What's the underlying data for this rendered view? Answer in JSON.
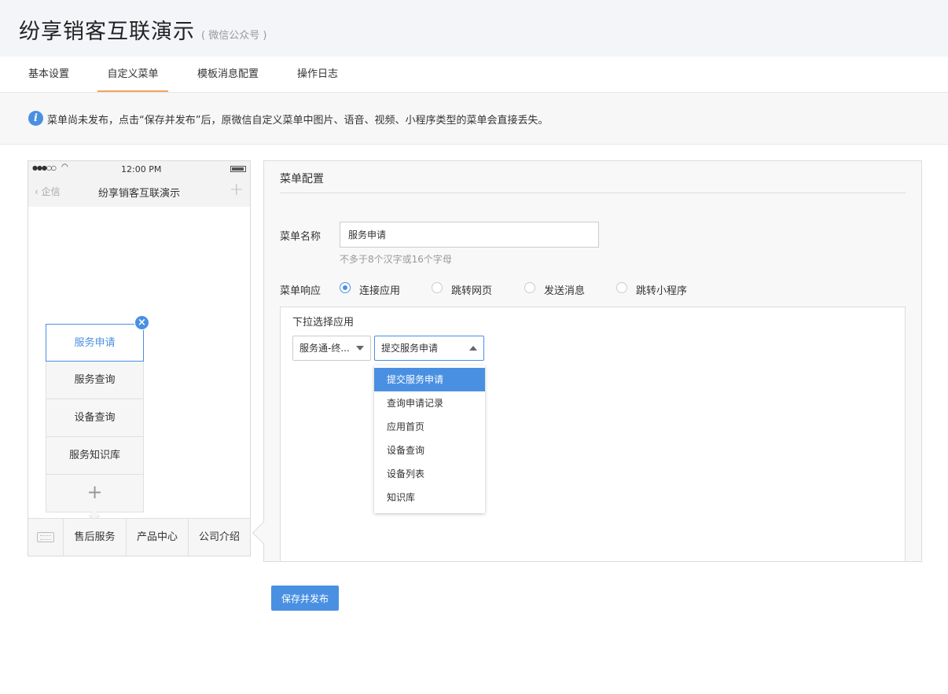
{
  "header": {
    "title": "纷享销客互联演示",
    "subtitle": "( 微信公众号 )"
  },
  "tabs": [
    {
      "label": "基本设置"
    },
    {
      "label": "自定义菜单"
    },
    {
      "label": "模板消息配置"
    },
    {
      "label": "操作日志"
    }
  ],
  "notice": {
    "icon": "info-icon",
    "text": "菜单尚未发布，点击“保存并发布”后，原微信自定义菜单中图片、语音、视频、小程序类型的菜单会直接丢失。"
  },
  "phone": {
    "time": "12:00 PM",
    "back_label": "企信",
    "nav_title": "纷享销客互联演示",
    "submenu": [
      {
        "label": "服务申请"
      },
      {
        "label": "服务查询"
      },
      {
        "label": "设备查询"
      },
      {
        "label": "服务知识库"
      }
    ],
    "menu": [
      {
        "label": "售后服务"
      },
      {
        "label": "产品中心"
      },
      {
        "label": "公司介绍"
      }
    ]
  },
  "config": {
    "title": "菜单配置",
    "name_label": "菜单名称",
    "name_value": "服务申请",
    "name_hint": "不多于8个汉字或16个字母",
    "response_label": "菜单响应",
    "responses": [
      {
        "label": "连接应用"
      },
      {
        "label": "跳转网页"
      },
      {
        "label": "发送消息"
      },
      {
        "label": "跳转小程序"
      }
    ],
    "app_select_label": "下拉选择应用",
    "app_select_value": "服务通-终...",
    "page_select_value": "提交服务申请",
    "page_options": [
      {
        "label": "提交服务申请"
      },
      {
        "label": "查询申请记录"
      },
      {
        "label": "应用首页"
      },
      {
        "label": "设备查询"
      },
      {
        "label": "设备列表"
      },
      {
        "label": "知识库"
      }
    ]
  },
  "save_button": "保存并发布",
  "colors": {
    "accent": "#4a90e2",
    "tab_indicator": "#f0a35e"
  }
}
